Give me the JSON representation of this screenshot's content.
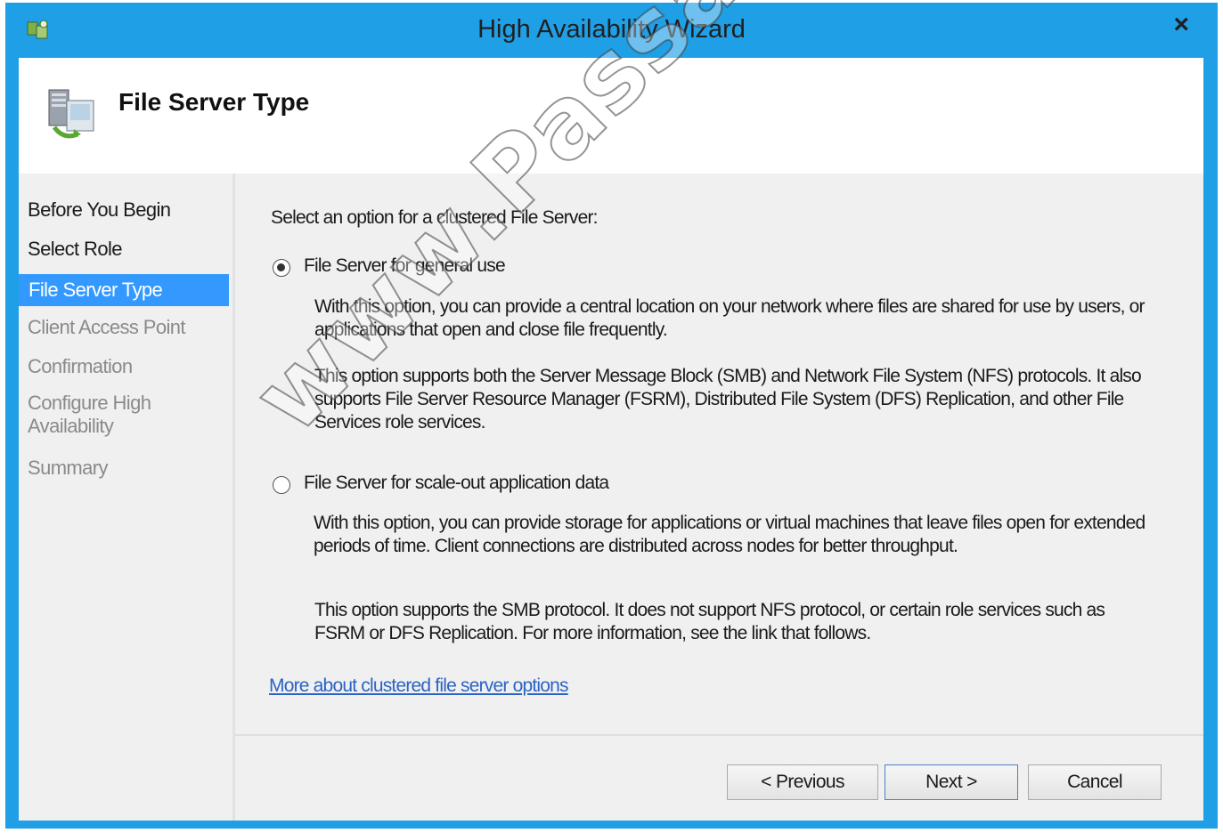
{
  "window": {
    "title": "High Availability Wizard",
    "close_glyph": "×"
  },
  "header": {
    "title": "File Server Type"
  },
  "steps": [
    {
      "label": "Before You Begin",
      "state": "done"
    },
    {
      "label": "Select Role",
      "state": "done"
    },
    {
      "label": "File Server Type",
      "state": "active"
    },
    {
      "label": "Client Access Point",
      "state": "pending"
    },
    {
      "label": "Confirmation",
      "state": "pending"
    },
    {
      "label": "Configure High Availability",
      "state": "pending"
    },
    {
      "label": "Summary",
      "state": "pending"
    }
  ],
  "main": {
    "prompt": "Select an option for a clustered File Server:",
    "option1": {
      "label": "File Server for general use",
      "selected": true,
      "desc1": "With this option, you can provide a central location on your network where files are shared for use by users, or applications that open and close file frequently.",
      "desc2": "This option supports both the Server Message Block (SMB) and Network File System (NFS) protocols. It also supports File Server Resource Manager (FSRM), Distributed File System (DFS) Replication, and other File Services role services."
    },
    "option2": {
      "label": "File Server for scale-out application data",
      "selected": false,
      "desc1": "With this option, you can provide storage for applications or virtual machines that leave files open for extended periods of time. Client connections are distributed across nodes for better throughput.",
      "desc2": "This option supports the SMB protocol. It does not support NFS protocol, or certain role services such as FSRM or DFS Replication. For more information, see the link that follows."
    },
    "link": "More about clustered file server options"
  },
  "footer": {
    "previous": "< Previous",
    "next": "Next >",
    "cancel": "Cancel"
  },
  "watermark": "www.Passapply.com",
  "colors": {
    "titlebar": "#1f9fe6",
    "active_step": "#3399ff",
    "link": "#2b63c6"
  }
}
